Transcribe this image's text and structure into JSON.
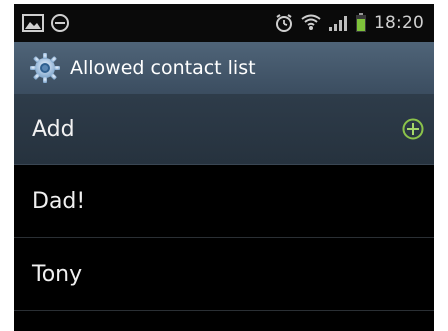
{
  "status_bar": {
    "time": "18:20",
    "left_icons": [
      "picture-icon",
      "minus-circle-icon"
    ],
    "right_icons": [
      "alarm-icon",
      "wifi-icon",
      "signal-icon",
      "battery-icon"
    ]
  },
  "title_bar": {
    "title": "Allowed contact list",
    "icon": "gear-icon"
  },
  "add_row": {
    "label": "Add",
    "icon": "add-circle-icon"
  },
  "contacts": [
    {
      "name": "Dad!"
    },
    {
      "name": "Tony"
    }
  ],
  "colors": {
    "title_bar": "#46596c",
    "add_row": "#2b3744",
    "accent_green": "#8bc34a",
    "battery_green": "#7ec23a"
  }
}
